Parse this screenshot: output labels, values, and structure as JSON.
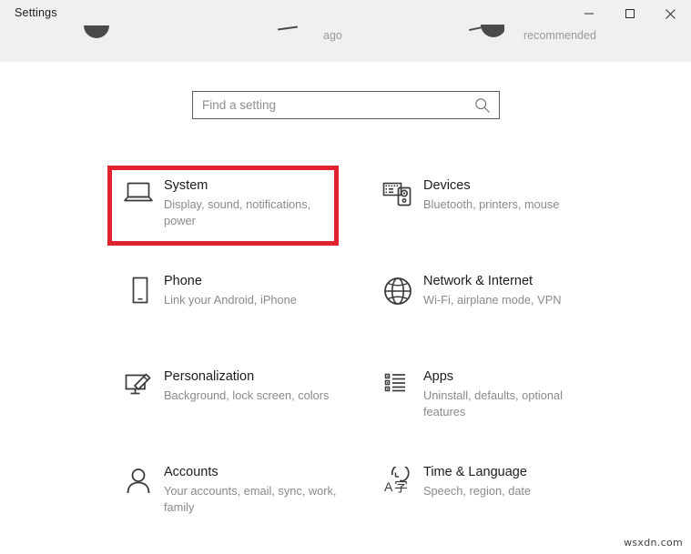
{
  "window": {
    "title": "Settings",
    "controls": [
      {
        "name": "minimize",
        "glyph": "minimize-icon"
      },
      {
        "name": "maximize",
        "glyph": "maximize-icon"
      },
      {
        "name": "close",
        "glyph": "close-icon"
      }
    ]
  },
  "background_fragments": {
    "text_ago": "ago",
    "text_recommended": "recommended"
  },
  "search": {
    "placeholder": "Find a setting",
    "value": "",
    "icon": "search-icon"
  },
  "tiles": [
    {
      "title": "System",
      "desc": "Display, sound, notifications, power",
      "icon": "laptop-icon",
      "highlighted": true
    },
    {
      "title": "Devices",
      "desc": "Bluetooth, printers, mouse",
      "icon": "devices-icon",
      "highlighted": false
    },
    {
      "title": "Phone",
      "desc": "Link your Android, iPhone",
      "icon": "phone-icon",
      "highlighted": false
    },
    {
      "title": "Network & Internet",
      "desc": "Wi-Fi, airplane mode, VPN",
      "icon": "globe-icon",
      "highlighted": false
    },
    {
      "title": "Personalization",
      "desc": "Background, lock screen, colors",
      "icon": "personalization-icon",
      "highlighted": false
    },
    {
      "title": "Apps",
      "desc": "Uninstall, defaults, optional features",
      "icon": "apps-list-icon",
      "highlighted": false
    },
    {
      "title": "Accounts",
      "desc": "Your accounts, email, sync, work, family",
      "icon": "person-icon",
      "highlighted": false
    },
    {
      "title": "Time & Language",
      "desc": "Speech, region, date",
      "icon": "time-language-icon",
      "highlighted": false
    }
  ],
  "watermark": "wsxdn.com",
  "colors": {
    "highlight": "#e0232e",
    "titlebar_bg": "#f0f0f0",
    "title_text": "#1c1c1c",
    "desc_text": "#8a8a8a"
  }
}
